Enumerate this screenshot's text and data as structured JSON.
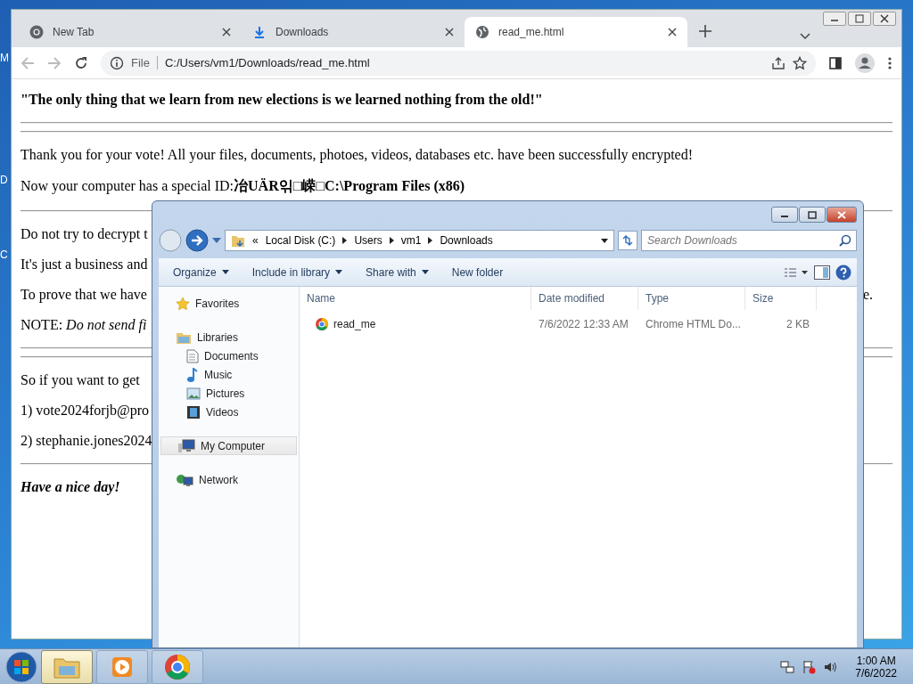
{
  "desktop_labels": [
    "M",
    "D",
    "C"
  ],
  "browser": {
    "tabs": [
      {
        "label": "New Tab",
        "selected": false
      },
      {
        "label": "Downloads",
        "selected": false
      },
      {
        "label": "read_me.html",
        "selected": true
      }
    ],
    "address": {
      "scheme": "File",
      "url": "C:/Users/vm1/Downloads/read_me.html"
    },
    "page": [
      {
        "kind": "heading",
        "text": "\"The only thing that we learn from new elections is we learned nothing from the old!\""
      },
      {
        "kind": "rule"
      },
      {
        "kind": "rule"
      },
      {
        "kind": "para",
        "text": "Thank you for your vote! All your files, documents, photoes, videos, databases etc. have been successfully encrypted!"
      },
      {
        "kind": "para",
        "text": "Now your computer has a special ID:**冶UÄR읶□嵘□C:\\Program Files (x86)**"
      },
      {
        "kind": "rule"
      },
      {
        "kind": "para",
        "text": "Do not try to decrypt t"
      },
      {
        "kind": "para",
        "text": "It's just a business and"
      },
      {
        "kind": "para",
        "text": "To prove that we have",
        "tail": "e."
      },
      {
        "kind": "para",
        "text": "NOTE: *Do not send fi*"
      },
      {
        "kind": "rule"
      },
      {
        "kind": "rule"
      },
      {
        "kind": "para",
        "text": "So if you want to get"
      },
      {
        "kind": "para",
        "text": "1) vote2024forjb@pro"
      },
      {
        "kind": "para",
        "text": "2) stephanie.jones2024"
      },
      {
        "kind": "rule"
      },
      {
        "kind": "signoff",
        "text": "Have a nice day!"
      }
    ]
  },
  "explorer": {
    "breadcrumb": [
      "«",
      "Local Disk (C:)",
      "Users",
      "vm1",
      "Downloads"
    ],
    "search": {
      "placeholder": "Search Downloads"
    },
    "toolbar": [
      {
        "label": "Organize",
        "dropdown": true
      },
      {
        "label": "Include in library",
        "dropdown": true
      },
      {
        "label": "Share with",
        "dropdown": true
      },
      {
        "label": "New folder",
        "dropdown": false
      }
    ],
    "nav": [
      {
        "label": "Favorites",
        "selected": false
      },
      {
        "label": "Libraries",
        "selected": false,
        "children": [
          {
            "label": "Documents",
            "selected": false
          },
          {
            "label": "Music",
            "selected": false
          },
          {
            "label": "Pictures",
            "selected": false
          },
          {
            "label": "Videos",
            "selected": false
          }
        ]
      },
      {
        "label": "My Computer",
        "selected": true
      },
      {
        "label": "Network",
        "selected": false
      }
    ],
    "columns": [
      "Name",
      "Date modified",
      "Type",
      "Size"
    ],
    "rows": [
      {
        "name": "read_me",
        "date": "7/6/2022 12:33 AM",
        "type": "Chrome HTML Do...",
        "size": "2 KB"
      }
    ]
  },
  "taskbar": {
    "apps": [
      {
        "selected": true
      },
      {
        "selected": false
      },
      {
        "selected": false
      }
    ],
    "time": "1:00 AM",
    "date": "7/6/2022"
  }
}
